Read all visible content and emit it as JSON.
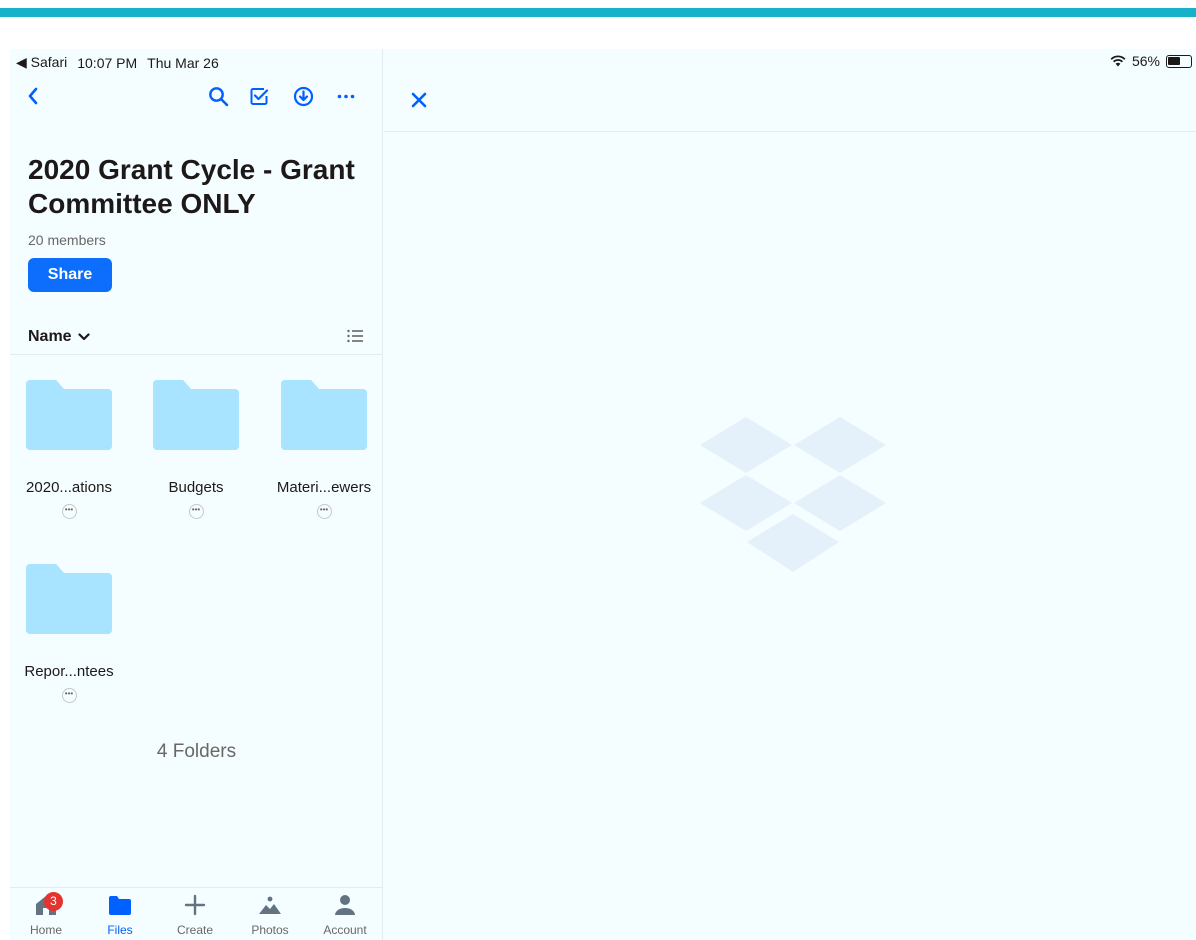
{
  "status_bar": {
    "back_app": "◀ Safari",
    "time": "10:07 PM",
    "date": "Thu Mar 26",
    "battery": "56%"
  },
  "folder_view": {
    "title": "2020 Grant Cycle - Grant Committee ONLY",
    "members": "20 members",
    "share_label": "Share",
    "sort_label": "Name",
    "folders": [
      {
        "name": "2020...ations"
      },
      {
        "name": "Budgets"
      },
      {
        "name": "Materi...ewers"
      },
      {
        "name": "Repor...ntees"
      }
    ],
    "folder_count": "4 Folders"
  },
  "tab_bar": {
    "tabs": [
      {
        "label": "Home",
        "badge": "3"
      },
      {
        "label": "Files"
      },
      {
        "label": "Create"
      },
      {
        "label": "Photos"
      },
      {
        "label": "Account"
      }
    ]
  },
  "colors": {
    "accent": "#0061fe",
    "folder": "#a8e3ff",
    "stripe": "#16b3c8",
    "background": "#f4fdff"
  }
}
